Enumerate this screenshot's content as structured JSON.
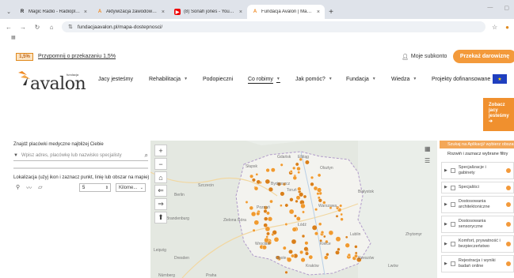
{
  "browser": {
    "tabs": [
      {
        "icon": "dropdown-icon",
        "title": ""
      },
      {
        "title": "Magic Radio - Radioplayer",
        "icon_text": "R"
      },
      {
        "title": "Aktywizacja zawodowa osób z",
        "icon_text": "A"
      },
      {
        "title": "(8) Sonah jones - YouTube",
        "icon_text": "▶"
      },
      {
        "title": "Fundacja Avalon | Mapa Dostę",
        "icon_text": "A",
        "active": true
      }
    ],
    "url": "fundacjaavalon.pl/mapa-dostepnosci/",
    "bookmarks_icon": "▦"
  },
  "header": {
    "one_percent": "1,5%",
    "remind_link": "Przypomnij o przekazaniu 1,5%",
    "subaccount": "Moje subkonto",
    "donate": "Przekaż darowiznę",
    "logo_small": "fundacja",
    "logo_word": "avalon",
    "nav": [
      {
        "label": "Jacy jesteśmy",
        "chev": false
      },
      {
        "label": "Rehabilitacja",
        "chev": true
      },
      {
        "label": "Podopieczni",
        "chev": false
      },
      {
        "label": "Co robimy",
        "chev": true,
        "active": true
      },
      {
        "label": "Jak pomóc?",
        "chev": true
      },
      {
        "label": "Fundacja",
        "chev": true
      },
      {
        "label": "Wiedza",
        "chev": true
      },
      {
        "label": "Projekty dofinansowane",
        "chev": false
      }
    ]
  },
  "sidebar_cta": {
    "line1": "Zobacz",
    "line2": "jacy",
    "line3": "jesteśmy",
    "arrow": "➔"
  },
  "finder": {
    "title": "Znajdź placówki medyczne najbliżej Ciebie",
    "search_placeholder": "Wpisz adres, placówkę lub nazwisko specjalisty",
    "location_label": "Lokalizacja (użyj ikon i zaznacz punkt, linię lub obszar na mapie)",
    "radius_value": "5",
    "unit": "Kilome..."
  },
  "map": {
    "labels": [
      "Słupsk",
      "Gdańsk",
      "Elbląg",
      "Olsztyn",
      "Szczecin",
      "Bydgoszcz",
      "Toruń",
      "Białystok",
      "Poznań",
      "Warszawa",
      "Zielona Góra",
      "Łódź",
      "Lublin",
      "Wrocław",
      "Kielce",
      "Rzeszów",
      "Opole",
      "Kraków",
      "Lwów",
      "Zhytomyr",
      "Brandenburg",
      "Dresden",
      "Leipzig",
      "Nürnberg",
      "Berlin",
      "Praha"
    ],
    "zoom_in": "+",
    "zoom_out": "−"
  },
  "filters": {
    "header": "Szukaj na Aplikacji/ wybierz obszar",
    "subtitle": "Rozwiń i zaznacz wybrane filtry",
    "items": [
      "Specjalizacje i gabinety",
      "Specjaliści",
      "Dostosowania architektoniczne",
      "Dostosowania sensoryczne",
      "Komfort, prywatność i bezpieczeństwo",
      "Rejestracja i wyniki badań online"
    ]
  }
}
